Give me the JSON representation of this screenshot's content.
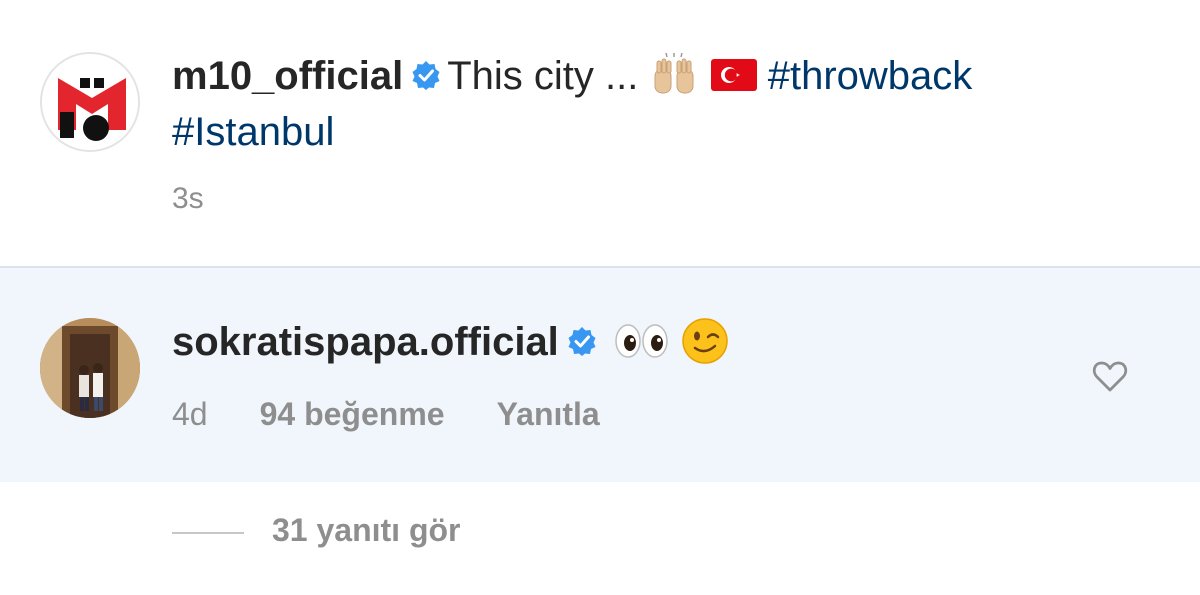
{
  "post": {
    "username": "m10_official",
    "caption_text": "This city ...",
    "hashtag_1": "#throwback",
    "hashtag_2": "#Istanbul",
    "time": "3s",
    "emojis": [
      "raising-hands-emoji",
      "turkey-flag-emoji"
    ]
  },
  "comment": {
    "username": "sokratispapa.official",
    "emojis": [
      "eyes-emoji",
      "winking-face-emoji"
    ],
    "age": "4d",
    "likes": "94 beğenme",
    "reply_label": "Yanıtla"
  },
  "replies": {
    "label": "31 yanıtı gör"
  },
  "colors": {
    "text": "#262626",
    "muted": "#8e8e8e",
    "hashtag": "#00376b",
    "verified": "#3897f0",
    "comment_bg": "#f0f6fc",
    "logo_red": "#e3262d"
  }
}
